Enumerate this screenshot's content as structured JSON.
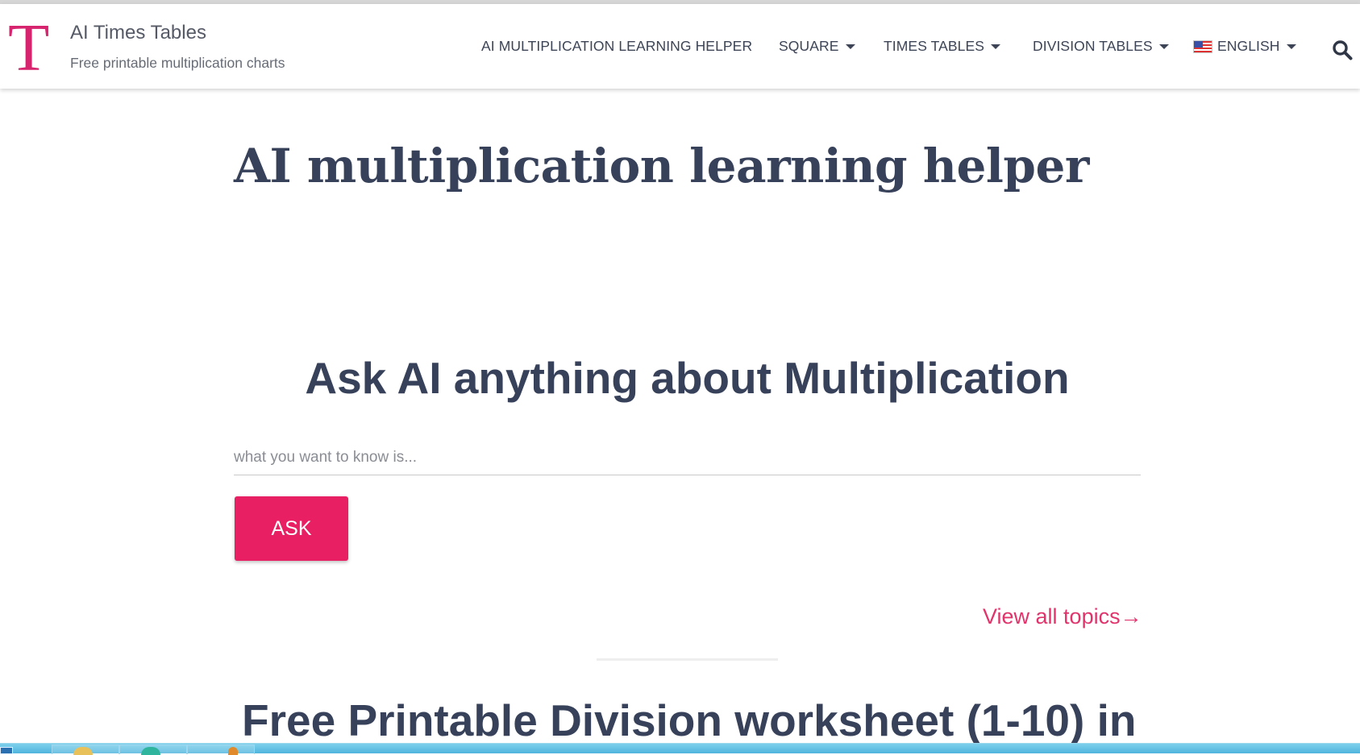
{
  "site": {
    "logo_letter": "T",
    "title": "AI Times Tables",
    "tagline": "Free printable multiplication charts"
  },
  "nav": {
    "items": [
      {
        "label": "AI MULTIPLICATION LEARNING HELPER",
        "has_dropdown": false
      },
      {
        "label": "SQUARE",
        "has_dropdown": true
      },
      {
        "label": "TIMES TABLES",
        "has_dropdown": true
      },
      {
        "label": "DIVISION TABLES",
        "has_dropdown": true
      },
      {
        "label": "ENGLISH",
        "has_dropdown": true,
        "icon": "us-flag-icon"
      }
    ],
    "search_icon": "search-icon"
  },
  "main": {
    "page_title": "AI multiplication learning helper",
    "ask_heading": "Ask AI anything about Multiplication",
    "question_input": {
      "value": "",
      "placeholder": "what you want to know is..."
    },
    "ask_button_label": "ASK",
    "view_topics_link": "View all topics→",
    "section_heading": "Free Printable Division worksheet (1-10) in"
  },
  "colors": {
    "accent": "#e91f63",
    "logo": "#d6246e",
    "heading_text": "#37425a",
    "link": "#e0346c",
    "taskbar": "#5ec0e4"
  }
}
